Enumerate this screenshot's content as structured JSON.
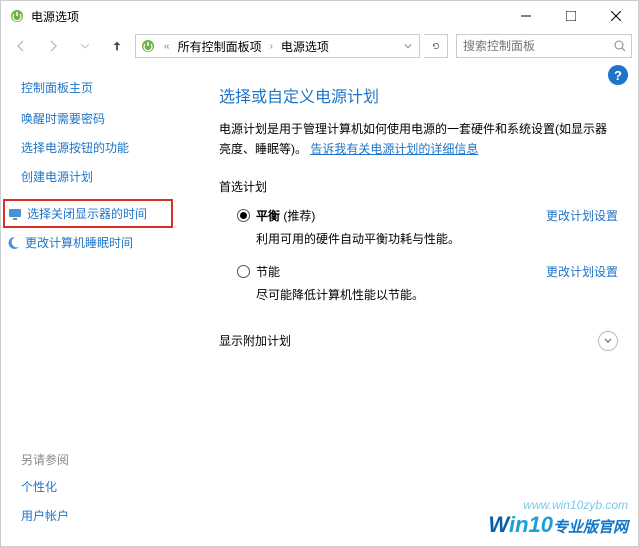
{
  "window": {
    "title": "电源选项"
  },
  "breadcrumb": {
    "sep1": "«",
    "item1": "所有控制面板项",
    "item2": "电源选项"
  },
  "search": {
    "placeholder": "搜索控制面板"
  },
  "sidebar": {
    "home": "控制面板主页",
    "links": {
      "wake": "唤醒时需要密码",
      "button": "选择电源按钮的功能",
      "create": "创建电源计划",
      "display": "选择关闭显示器的时间",
      "sleep": "更改计算机睡眠时间"
    },
    "seealso": "另请参阅",
    "seealso_links": {
      "personalize": "个性化",
      "account": "用户帐户"
    }
  },
  "main": {
    "title": "选择或自定义电源计划",
    "desc_prefix": "电源计划是用于管理计算机如何使用电源的一套硬件和系统设置(如显示器亮度、睡眠等)。",
    "desc_link": "告诉我有关电源计划的详细信息",
    "preferred": "首选计划",
    "plan1": {
      "name": "平衡",
      "tag": "(推荐)",
      "link": "更改计划设置",
      "desc": "利用可用的硬件自动平衡功耗与性能。"
    },
    "plan2": {
      "name": "节能",
      "link": "更改计划设置",
      "desc": "尽可能降低计算机性能以节能。"
    },
    "additional": "显示附加计划"
  },
  "watermark": {
    "url": "www.win10zyb.com",
    "brand": "Win10",
    "suffix": "专业版官网"
  }
}
